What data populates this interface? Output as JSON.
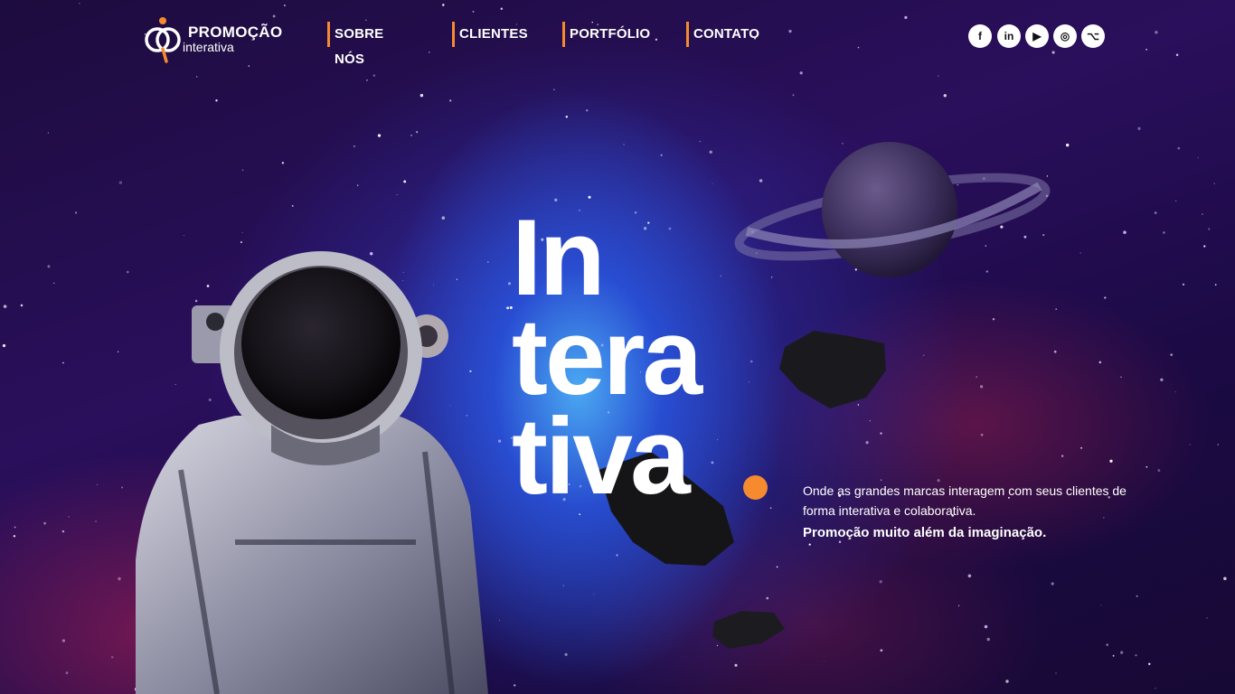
{
  "brand": {
    "name_line1": "PROMOÇÃO",
    "name_line2": "interativa",
    "accent_color": "#f58a2e"
  },
  "nav": {
    "items": [
      {
        "label": "SOBRE NÓS"
      },
      {
        "label": "CLIENTES"
      },
      {
        "label": "PORTFÓLIO"
      },
      {
        "label": "CONTATO"
      }
    ]
  },
  "socials": [
    {
      "icon": "facebook-icon",
      "glyph": "f"
    },
    {
      "icon": "linkedin-icon",
      "glyph": "in"
    },
    {
      "icon": "youtube-icon",
      "glyph": "▶"
    },
    {
      "icon": "instagram-icon",
      "glyph": "◎"
    },
    {
      "icon": "github-icon",
      "glyph": "⌥"
    }
  ],
  "hero": {
    "line1": "In",
    "line2": "tera",
    "line3": "tiva",
    "tagline": "Onde as grandes marcas interagem com seus clientes de forma interativa e colaborativa.",
    "tagline_strong": "Promoção muito além da imaginação."
  },
  "illustration": {
    "elements": [
      "astronaut",
      "ringed-planet",
      "asteroid",
      "asteroid",
      "asteroid"
    ]
  }
}
